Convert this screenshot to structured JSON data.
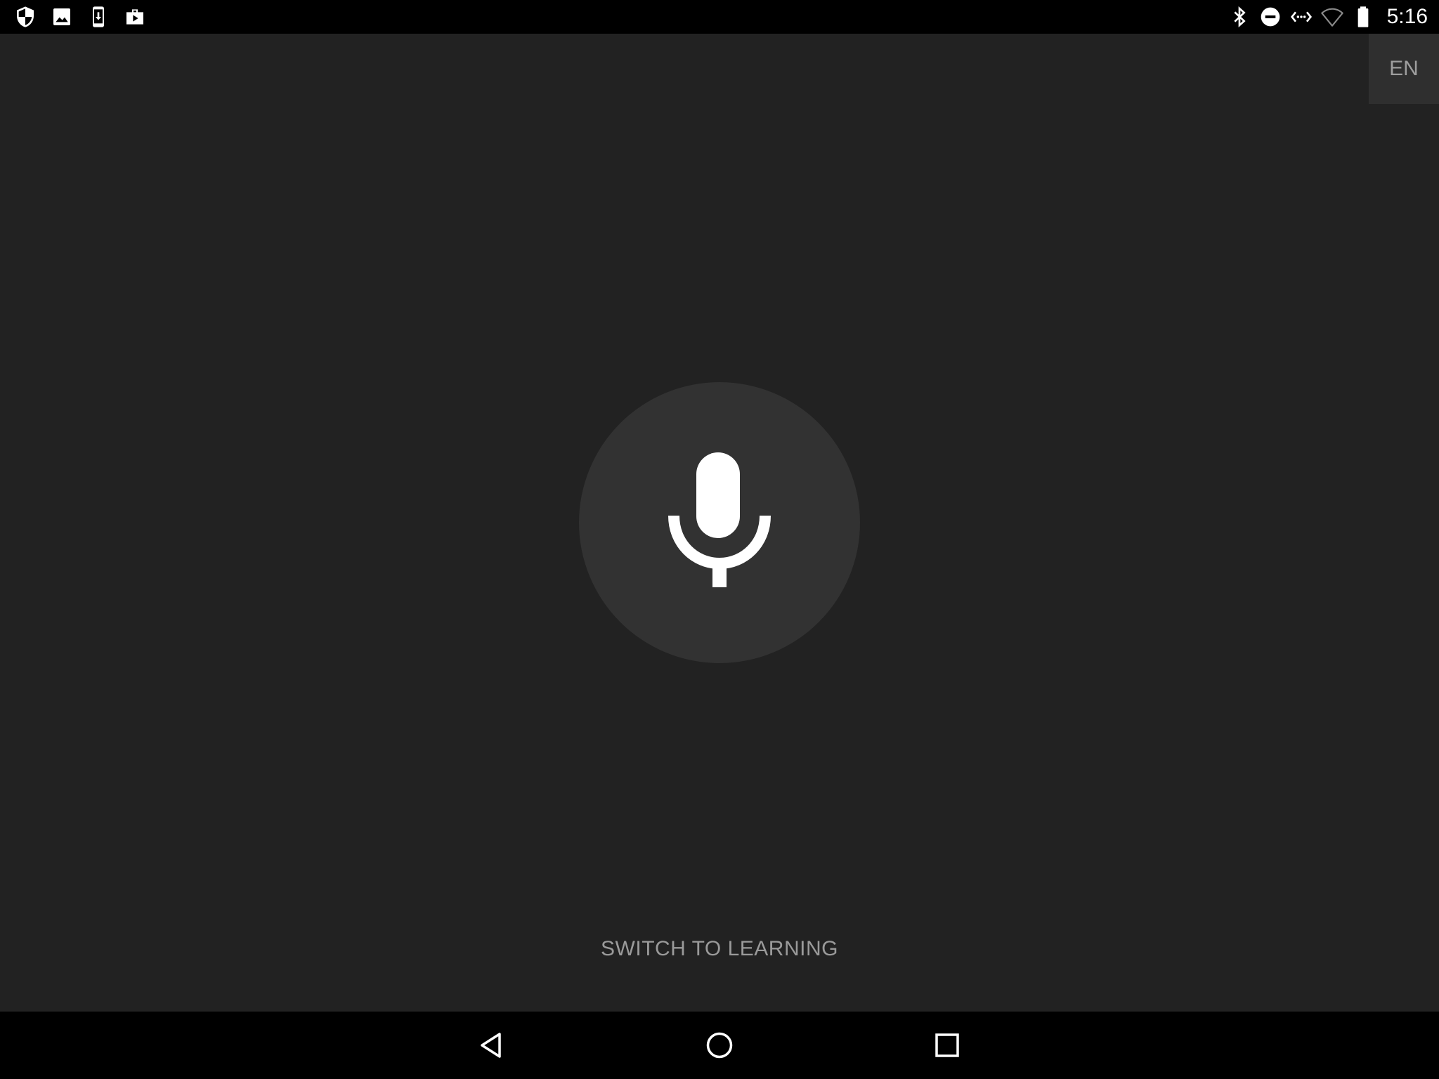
{
  "status_bar": {
    "time": "5:16",
    "left_icons": [
      "shield-icon",
      "image-icon",
      "download-icon",
      "shopping-bag-icon"
    ],
    "right_icons": [
      "bluetooth-icon",
      "do-not-disturb-icon",
      "data-sync-icon",
      "wifi-icon",
      "battery-icon"
    ]
  },
  "language": {
    "code": "EN"
  },
  "main": {
    "mic_icon": "microphone-icon",
    "switch_label": "SWITCH TO LEARNING"
  },
  "nav_bar": {
    "buttons": [
      "back-icon",
      "home-icon",
      "recents-icon"
    ]
  },
  "colors": {
    "background": "#222222",
    "bars": "#000000",
    "mic_circle": "#323232",
    "lang_chip": "#2f2f2f",
    "muted_text": "#9a9a9a",
    "icon": "#ffffff"
  }
}
